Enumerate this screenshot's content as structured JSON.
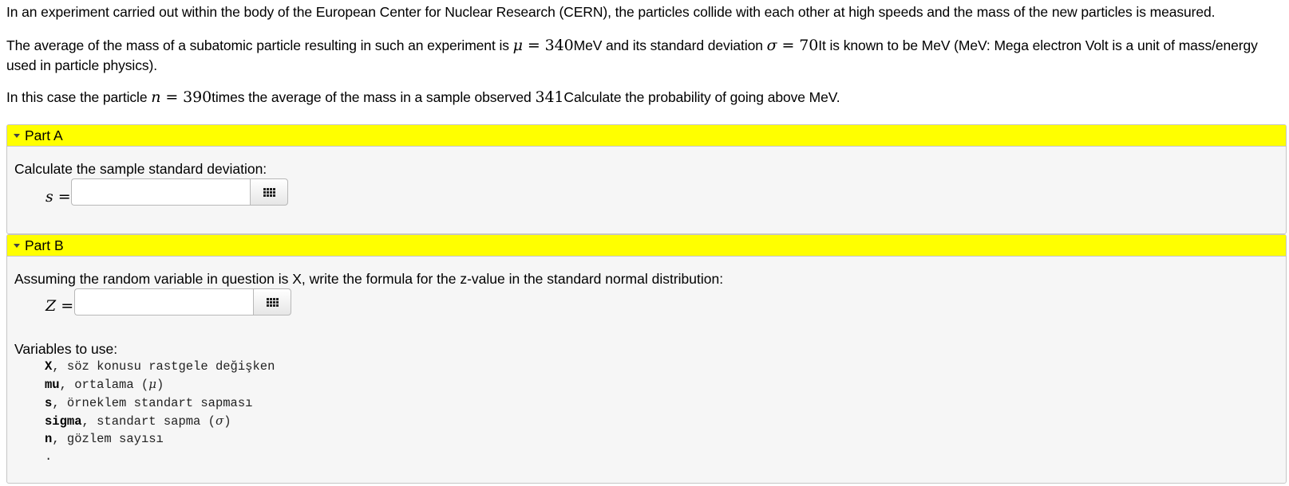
{
  "problem": {
    "intro": "In an experiment carried out within the body of the European Center for Nuclear Research (CERN), the particles collide with each other at high speeds and the mass of the new particles is measured.",
    "p2": {
      "t1": "The average of the mass of a subatomic particle resulting in such an experiment is ",
      "mu_sym": "μ",
      "eq1": " = 340",
      "t2": "MeV and its standard deviation ",
      "sigma_sym": "σ",
      "eq2": " = 70",
      "t3": "It is known to be MeV (MeV: Mega electron Volt is a unit of mass/energy used in particle physics)."
    },
    "p3": {
      "t1": "In this case the particle ",
      "n_sym": "n",
      "eq1": " = 390",
      "t2": "times the average of the mass in a sample observed ",
      "val": "341",
      "t3": "Calculate the probability of going above MeV."
    }
  },
  "partA": {
    "title": "Part A",
    "prompt": "Calculate the sample standard deviation:",
    "var": "s",
    "eq": " =",
    "input_value": ""
  },
  "partB": {
    "title": "Part B",
    "prompt": "Assuming the random variable in question is X, write the formula for the z-value in the standard normal distribution:",
    "var": "Z",
    "eq": " =",
    "input_value": "",
    "vars_title": "Variables to use:",
    "variables": [
      {
        "name": "X",
        "desc": " söz konusu rastgele değişken",
        "sym": ""
      },
      {
        "name": "mu",
        "desc": " ortalama (",
        "sym": "μ"
      },
      {
        "name": "s",
        "desc": " örneklem standart sapması",
        "sym": ""
      },
      {
        "name": "sigma",
        "desc": " standart sapma (",
        "sym": "σ"
      },
      {
        "name": "n",
        "desc": " gözlem sayısı",
        "sym": ""
      }
    ],
    "trailing": "."
  },
  "icons": {
    "keypad": "keypad-grid-icon",
    "caret": "caret-down-icon"
  },
  "colors": {
    "part_header": "#ffff00",
    "part_body": "#f6f6f6"
  }
}
